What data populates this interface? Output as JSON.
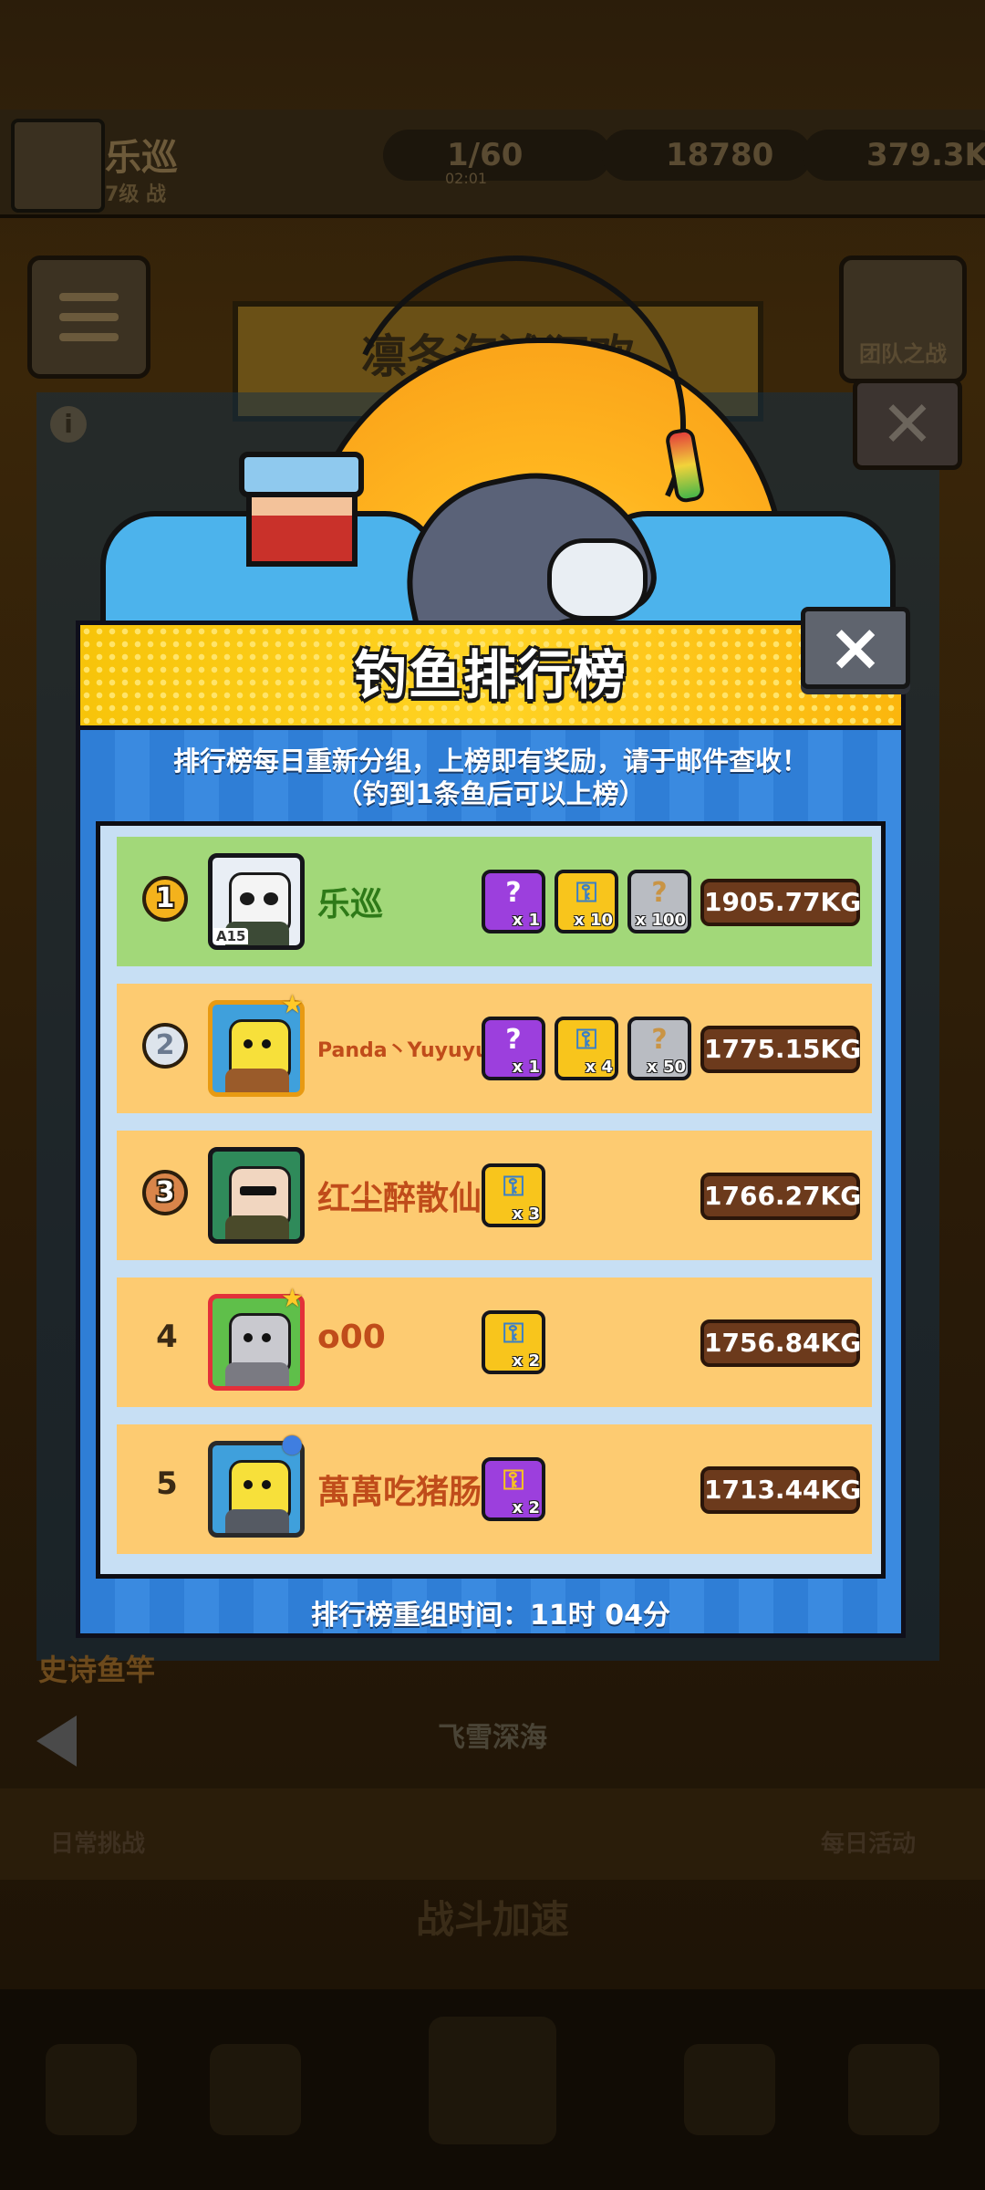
{
  "background": {
    "player_name": "乐巡",
    "player_level": "7级 战",
    "resources": [
      {
        "icon": "energy-icon",
        "value": "1/60",
        "sub": "02:01"
      },
      {
        "icon": "fish-coin-icon",
        "value": "18780"
      },
      {
        "icon": "gold-coin-icon",
        "value": "379.3K"
      }
    ],
    "event_title": "凛冬海滩狂欢",
    "side_button_label": "团队之战",
    "epic_rod_label": "史诗鱼竿",
    "region_label": "飞雪深海",
    "daily_left": "日常挑战",
    "daily_right": "每日活动",
    "boost_label": "战斗加速"
  },
  "modal": {
    "title": "钓鱼排行榜",
    "close_label": "×",
    "notice_line1": "排行榜每日重新分组，上榜即有奖励，请于邮件查收！",
    "notice_line2": "（钓到1条鱼后可以上榜）",
    "reset_text": "排行榜重组时间：11时 04分",
    "rows": [
      {
        "rank": "1",
        "medal": "gold",
        "name": "乐巡",
        "avatar": "panda-avatar",
        "avatar_level": "A15",
        "rewards": [
          {
            "type": "purple-chest",
            "qty": "x 1",
            "color": "#9c3fdd"
          },
          {
            "type": "key",
            "qty": "x 10",
            "color": "#f8c51c"
          },
          {
            "type": "mystery-box",
            "qty": "x 100",
            "color": "#b9bcc2"
          }
        ],
        "weight": "1905.77KG"
      },
      {
        "rank": "2",
        "medal": "silver",
        "name": "Panda丶Yuyuyu",
        "avatar": "sponge-avatar",
        "rewards": [
          {
            "type": "purple-chest",
            "qty": "x 1",
            "color": "#9c3fdd"
          },
          {
            "type": "key",
            "qty": "x 4",
            "color": "#f8c51c"
          },
          {
            "type": "mystery-box",
            "qty": "x 50",
            "color": "#b9bcc2"
          }
        ],
        "weight": "1775.15KG"
      },
      {
        "rank": "3",
        "medal": "bronze",
        "name": "红尘醉散仙",
        "avatar": "old-man-avatar",
        "rewards": [
          {
            "type": "key",
            "qty": "x 3",
            "color": "#f8c51c"
          }
        ],
        "weight": "1766.27KG"
      },
      {
        "rank": "4",
        "medal": "",
        "name": "o00",
        "avatar": "cat-avatar",
        "rewards": [
          {
            "type": "key",
            "qty": "x 2",
            "color": "#f8c51c"
          }
        ],
        "weight": "1756.84KG"
      },
      {
        "rank": "5",
        "medal": "",
        "name": "萬萬吃猪肠碌",
        "avatar": "sponge-avatar-2",
        "rewards": [
          {
            "type": "purple-key",
            "qty": "x 2",
            "color": "#9c3fdd"
          }
        ],
        "weight": "1713.44KG"
      }
    ]
  },
  "colors": {
    "header_yellow": "#ffd324",
    "panel_blue": "#2f7ed6",
    "row_first": "#a2d879",
    "row_other": "#fdcb71",
    "name_orange": "#c04c1a",
    "name_green": "#2e7a18",
    "weight_badge": "#6c3a1c"
  }
}
